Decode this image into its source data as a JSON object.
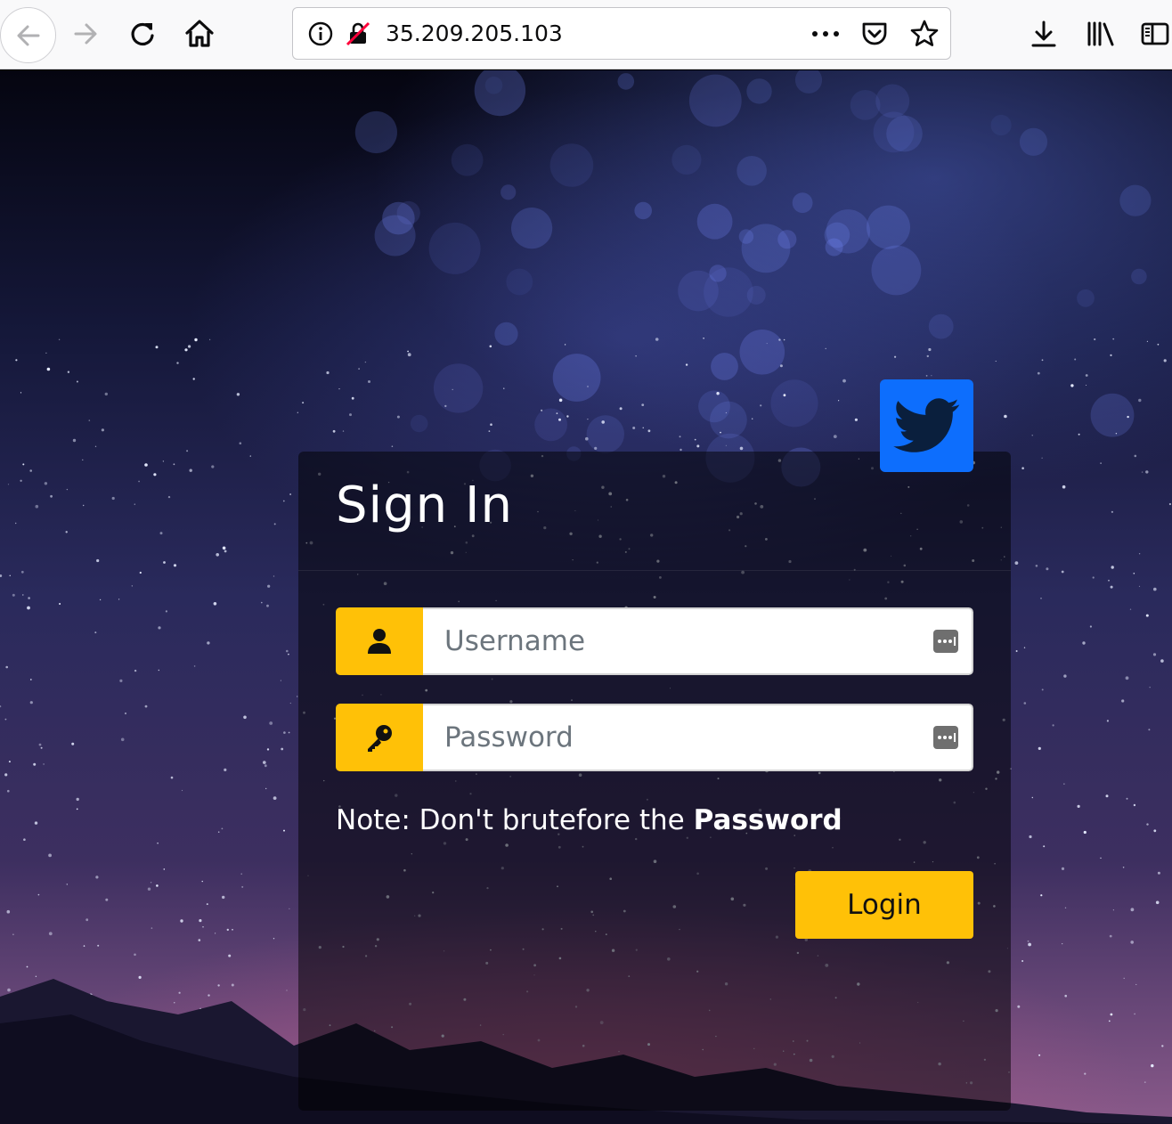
{
  "browser": {
    "url": "35.209.205.103",
    "icons": {
      "back": "back-arrow-icon",
      "forward": "forward-arrow-icon",
      "reload": "reload-icon",
      "home": "home-icon",
      "info": "info-icon",
      "insecure": "insecure-connection-icon",
      "more": "page-actions-icon",
      "pocket": "pocket-icon",
      "bookmark": "bookmark-star-icon",
      "downloads": "download-icon",
      "library": "library-icon",
      "sidebar": "sidebar-icon"
    }
  },
  "login": {
    "title": "Sign In",
    "username_placeholder": "Username",
    "password_placeholder": "Password",
    "note_prefix": "Note: Don't brutefore the ",
    "note_bold": "Password",
    "login_label": "Login",
    "social_icon": "twitter-icon"
  },
  "colors": {
    "accent": "#ffc107",
    "twitter": "#0d6efd"
  }
}
